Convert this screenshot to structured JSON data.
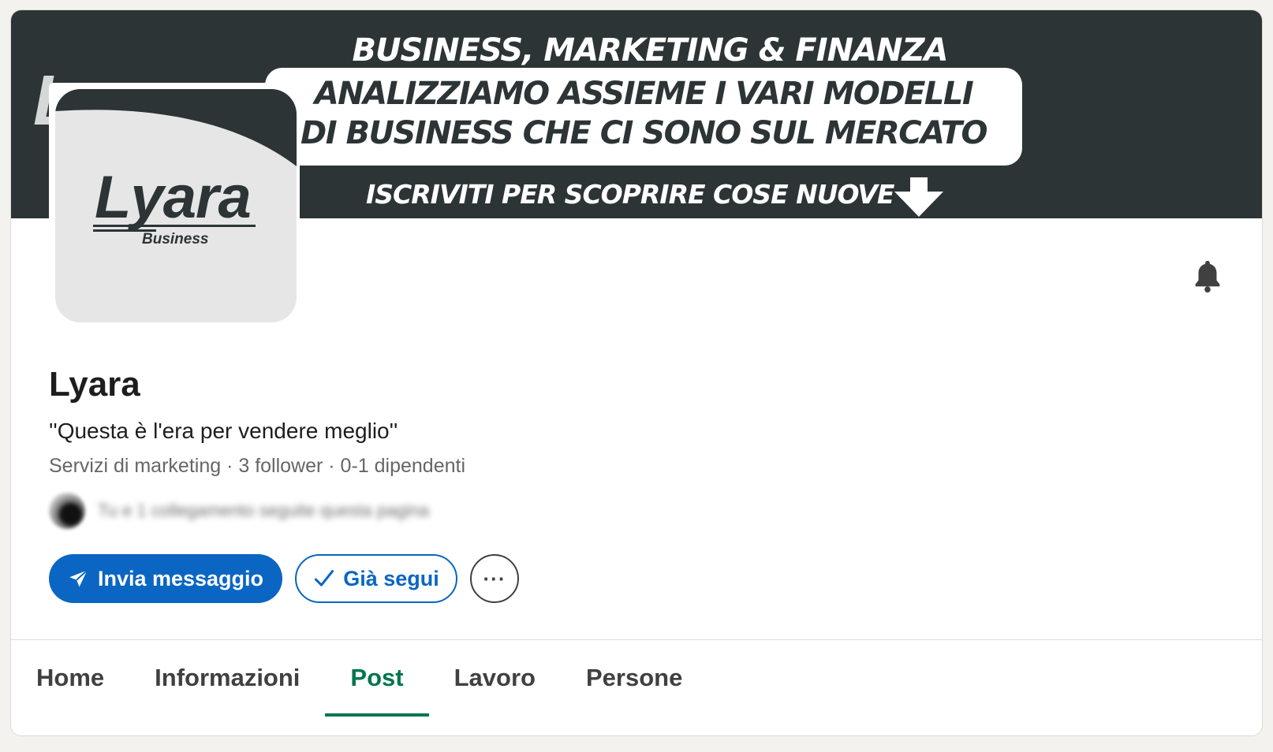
{
  "banner": {
    "faint_text": "Lyara",
    "headline": "BUSINESS, MARKETING & FINANZA",
    "box_line1": "ANALIZZIAMO ASSIEME I VARI MODELLI",
    "box_line2": "DI BUSINESS CHE CI SONO SUL MERCATO",
    "cta": "ISCRIVITI PER SCOPRIRE COSE NUOVE",
    "background_color": "#2d3436"
  },
  "logo": {
    "name": "Lyara",
    "subtitle": "Business"
  },
  "company": {
    "name": "Lyara",
    "tagline": "''Questa è l'era per vendere meglio''",
    "meta": "Servizi di marketing · 3 follower · 0-1 dipendenti",
    "connections_text": "Tu e 1 collegamento seguite questa pagina"
  },
  "actions": {
    "message_label": "Invia messaggio",
    "message_icon": "send-icon",
    "following_label": "Già segui",
    "following_icon": "check-icon",
    "more_label": "···",
    "primary_color": "#0a66c2"
  },
  "notifications": {
    "icon": "bell-icon"
  },
  "tabs": [
    {
      "label": "Home",
      "active": false
    },
    {
      "label": "Informazioni",
      "active": false
    },
    {
      "label": "Post",
      "active": true
    },
    {
      "label": "Lavoro",
      "active": false
    },
    {
      "label": "Persone",
      "active": false
    }
  ],
  "active_tab_color": "#01754f"
}
